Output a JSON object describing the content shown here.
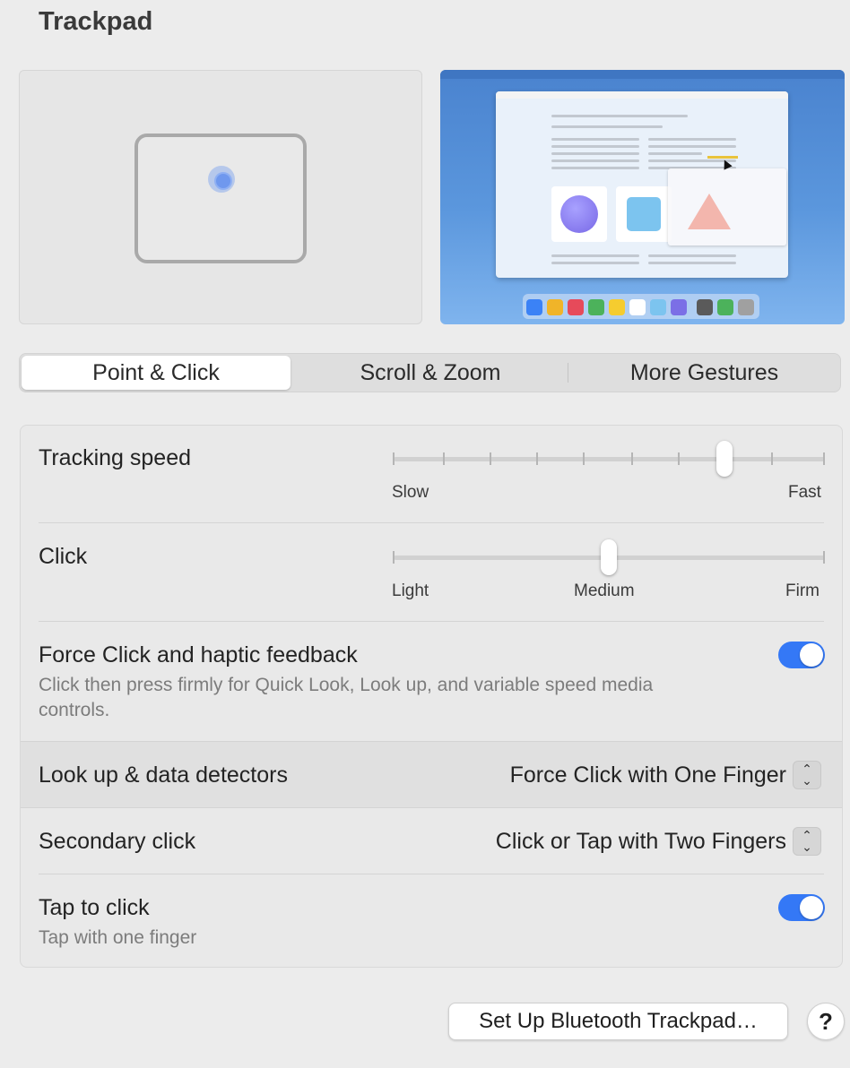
{
  "window": {
    "title": "Trackpad"
  },
  "tabs": [
    {
      "label": "Point & Click",
      "active": true
    },
    {
      "label": "Scroll & Zoom",
      "active": false
    },
    {
      "label": "More Gestures",
      "active": false
    }
  ],
  "tracking_speed": {
    "label": "Tracking speed",
    "min_label": "Slow",
    "max_label": "Fast",
    "tick_count": 10,
    "value_step": 8
  },
  "click": {
    "label": "Click",
    "labels": [
      "Light",
      "Medium",
      "Firm"
    ],
    "value": "Medium"
  },
  "force_click": {
    "label": "Force Click and haptic feedback",
    "description": "Click then press firmly for Quick Look, Look up, and variable speed media controls.",
    "enabled": true
  },
  "lookup": {
    "label": "Look up & data detectors",
    "value": "Force Click with One Finger"
  },
  "secondary_click": {
    "label": "Secondary click",
    "value": "Click or Tap with Two Fingers"
  },
  "tap_to_click": {
    "label": "Tap to click",
    "description": "Tap with one finger",
    "enabled": true
  },
  "footer": {
    "setup_button": "Set Up Bluetooth Trackpad…",
    "help_button": "?"
  },
  "colors": {
    "accent": "#3478f6",
    "background": "#ececec"
  }
}
